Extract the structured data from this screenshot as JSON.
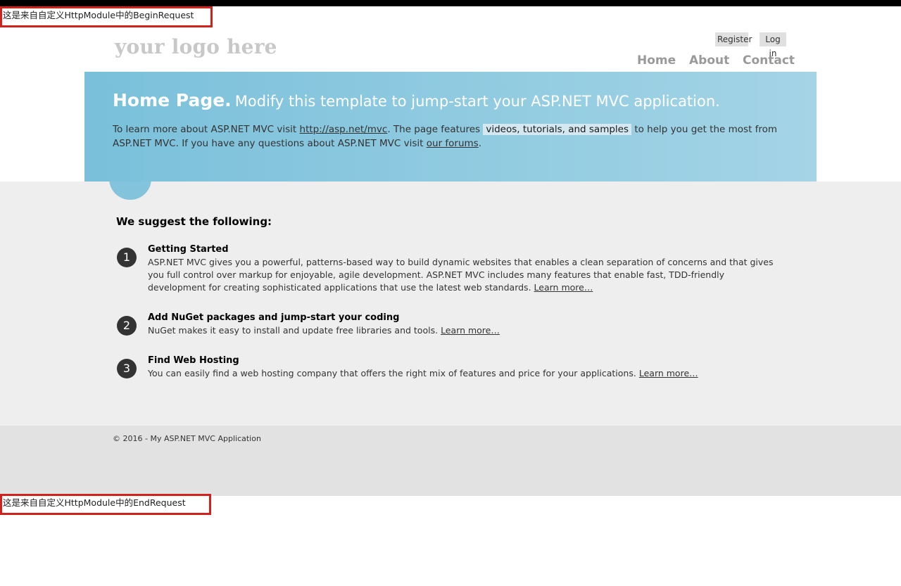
{
  "module_messages": {
    "begin": "这是来自自定义HttpModule中的BeginRequest",
    "end": "这是来自自定义HttpModule中的EndRequest"
  },
  "header": {
    "logo": "your logo here",
    "login": {
      "register": "Register",
      "log_in": "Log in"
    },
    "nav": {
      "home": "Home",
      "about": "About",
      "contact": "Contact"
    }
  },
  "featured": {
    "title_strong": "Home Page.",
    "title_rest": "Modify this template to jump-start your ASP.NET MVC application.",
    "text_1": "To learn more about ASP.NET MVC visit",
    "link_mvc": "http://asp.net/mvc",
    "text_2": ". The page features",
    "highlight": "videos, tutorials, and samples",
    "text_3": "to help you get the most from ASP.NET MVC. If you have any questions about ASP.NET MVC visit",
    "link_forums": "our forums",
    "text_4": "."
  },
  "main": {
    "heading": "We suggest the following:",
    "steps": [
      {
        "number": "1",
        "title": "Getting Started",
        "text": "ASP.NET MVC gives you a powerful, patterns-based way to build dynamic websites that enables a clean separation of concerns and that gives you full control over markup for enjoyable, agile development. ASP.NET MVC includes many features that enable fast, TDD-friendly development for creating sophisticated applications that use the latest web standards.",
        "link": "Learn more…"
      },
      {
        "number": "2",
        "title": "Add NuGet packages and jump-start your coding",
        "text": "NuGet makes it easy to install and update free libraries and tools.",
        "link": "Learn more…"
      },
      {
        "number": "3",
        "title": "Find Web Hosting",
        "text": "You can easily find a web hosting company that offers the right mix of features and price for your applications.",
        "link": "Learn more…"
      }
    ]
  },
  "footer": {
    "copyright": "© 2016 - My ASP.NET MVC Application"
  },
  "colors": {
    "banner_start": "#7ac0da",
    "banner_end": "#a4d4e6",
    "main_bg": "#efeeef",
    "footer_bg": "#e2e2e2",
    "module_border": "#d0211c"
  }
}
